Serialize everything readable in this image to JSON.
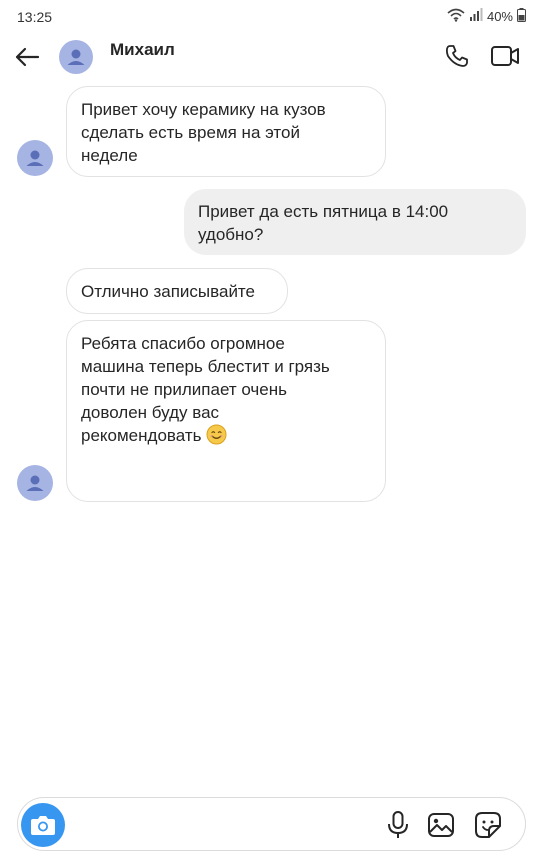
{
  "status_bar": {
    "time": "13:25",
    "battery": "40%"
  },
  "header": {
    "contact_name": "Михаил"
  },
  "messages": [
    {
      "direction": "incoming",
      "text": "Привет хочу керамику на кузов\nсделать есть время на этой\nнеделе"
    },
    {
      "direction": "outgoing",
      "text": "Привет да есть пятница в 14:00\nудобно?"
    },
    {
      "direction": "incoming",
      "text": "Отлично записывайте"
    },
    {
      "direction": "incoming",
      "text": "Ребята спасибо огромное\nмашина теперь блестит и грязь\nпочти не прилипает очень\nдоволен буду вас\nрекомендовать",
      "emoji": "smiling-face"
    }
  ],
  "composer": {
    "placeholder": ""
  },
  "colors": {
    "avatar_bg": "#a6b4e3",
    "outgoing_bubble": "#efefef",
    "camera_button": "#3797f0"
  }
}
